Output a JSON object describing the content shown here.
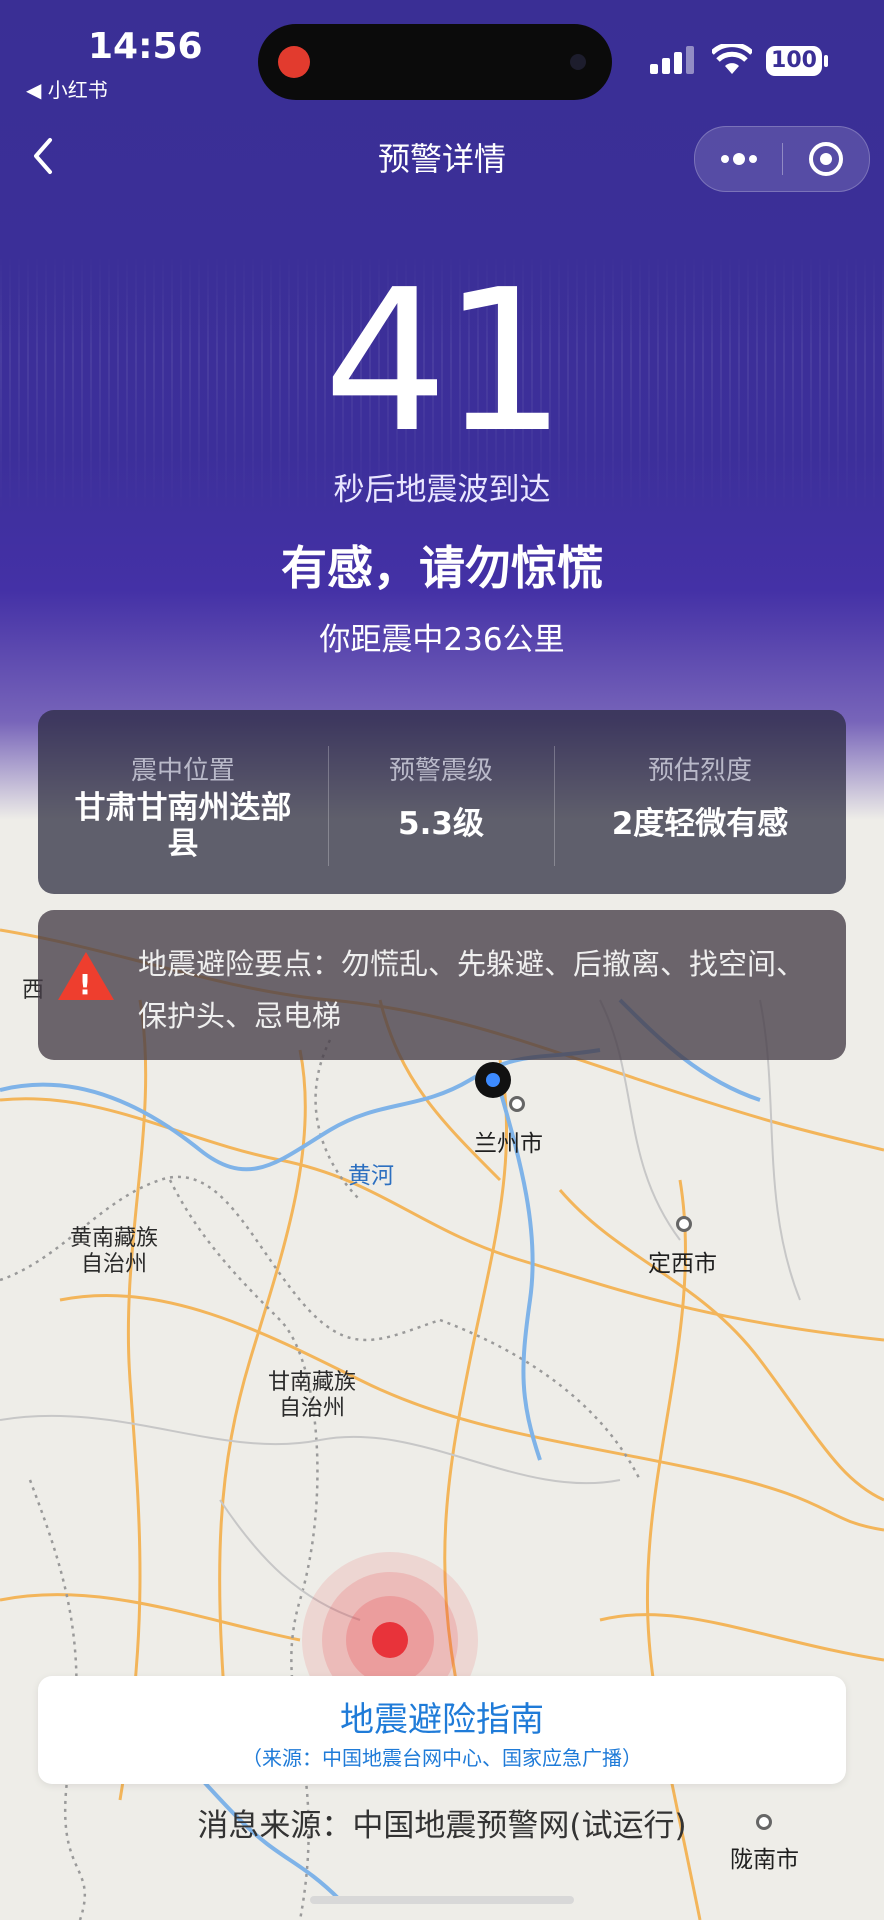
{
  "status_bar": {
    "time": "14:56",
    "back_app": "◀ 小红书",
    "battery": "100",
    "recording_color": "#e23b2e"
  },
  "nav": {
    "back_icon": "chevron-left-icon",
    "title": "预警详情",
    "more_icon": "more-dots-icon",
    "close_icon": "target-circle-icon"
  },
  "warning": {
    "seconds": "41",
    "seconds_label": "秒后地震波到达",
    "message": "有感，请勿惊慌",
    "distance": "你距震中236公里"
  },
  "info": {
    "epicenter_label": "震中位置",
    "epicenter_value": "甘肃甘南州迭部县",
    "magnitude_label": "预警震级",
    "magnitude_value": "5.3级",
    "intensity_label": "预估烈度",
    "intensity_value": "2度轻微有感"
  },
  "tips": {
    "icon": "warning-triangle-icon",
    "text": "地震避险要点：勿慌乱、先躲避、后撤离、找空间、保护头、忌电梯"
  },
  "map": {
    "labels": {
      "xi": "西",
      "lanzhou": "兰州市",
      "yellow_river": "黄河",
      "huangnan": "黄南藏族\n自治州",
      "dingxi": "定西市",
      "gannan": "甘南藏族\n自治州",
      "longnan": "陇南市"
    },
    "epicenter_color": "#e8333a",
    "user_location_color": "#3d8bff"
  },
  "guide": {
    "title": "地震避险指南",
    "subtitle": "（来源：中国地震台网中心、国家应急广播）"
  },
  "source": "消息来源：中国地震预警网(试运行)",
  "colors": {
    "header_purple": "#3a2f95",
    "link_blue": "#1f7bd8",
    "warning_red": "#ee3e2e"
  }
}
